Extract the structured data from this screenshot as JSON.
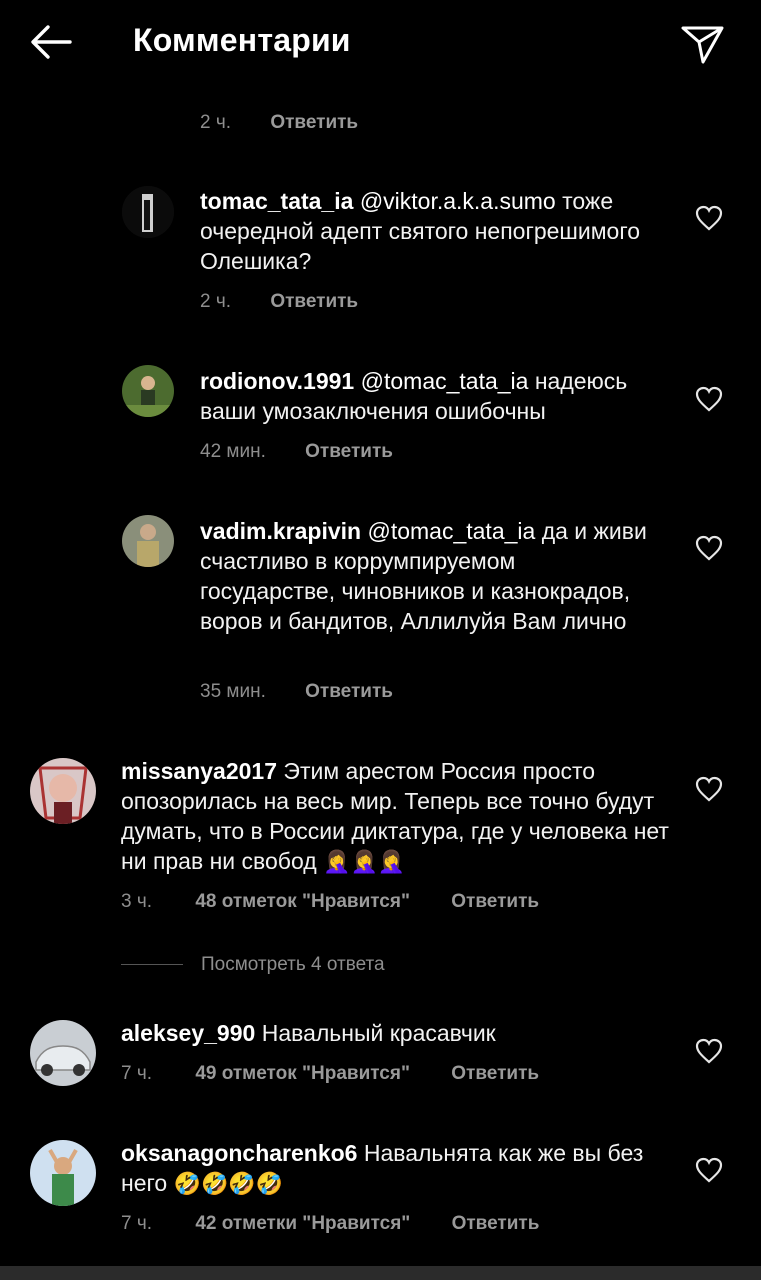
{
  "header": {
    "title": "Комментарии",
    "back_icon": "arrow-left-icon",
    "send_icon": "paper-plane-icon"
  },
  "partial_comment": {
    "time": "2 ч.",
    "reply": "Ответить"
  },
  "replies": [
    {
      "username": "tomac_tata_ia",
      "mention": "@viktor.a.k.a.sumo",
      "text": "тоже очередной адепт святого непогрешимого Олешика?",
      "time": "2 ч.",
      "reply": "Ответить"
    },
    {
      "username": "rodionov.1991",
      "mention": "@tomac_tata_ia",
      "text": "надеюсь ваши умозаключения ошибочны",
      "time": "42 мин.",
      "reply": "Ответить"
    },
    {
      "username": "vadim.krapivin",
      "mention": "@tomac_tata_ia",
      "text": "да и живи счастливо в коррумпируемом государстве, чиновников и казнокрадов, воров и бандитов, Аллилуйя Вам лично",
      "time": "35 мин.",
      "reply": "Ответить"
    }
  ],
  "comments": [
    {
      "username": "missanya2017",
      "text": "Этим арестом Россия просто опозорилась на весь мир. Теперь все точно будут думать, что в России диктатура, где у человека нет ни прав ни свобод",
      "emoji": "🤦‍♀️🤦‍♀️🤦‍♀️",
      "time": "3 ч.",
      "likes": "48 отметок \"Нравится\"",
      "reply": "Ответить"
    },
    {
      "username": "aleksey_990",
      "text": "Навальный красавчик",
      "time": "7 ч.",
      "likes": "49 отметок \"Нравится\"",
      "reply": "Ответить"
    },
    {
      "username": "oksanagoncharenko6",
      "text": "Навальнята как же вы без него",
      "emoji": "🤣🤣🤣🤣",
      "time": "7 ч.",
      "likes": "42 отметки \"Нравится\"",
      "reply": "Ответить"
    }
  ],
  "view_replies": "Посмотреть 4 ответа",
  "icons": {
    "like": "heart-outline-icon"
  }
}
